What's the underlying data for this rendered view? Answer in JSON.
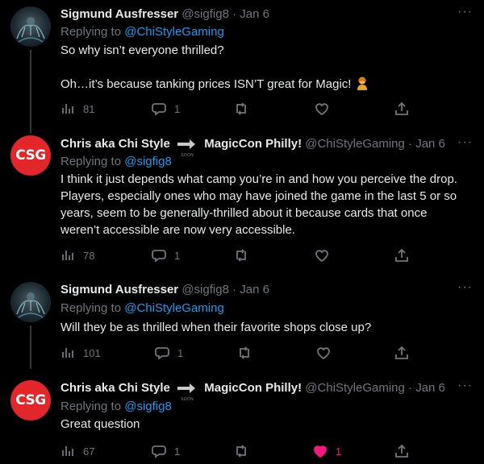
{
  "tweets": [
    {
      "name": "Sigmund Ausfresser",
      "handle": "@sigfig8",
      "dot": "·",
      "date": "Jan 6",
      "replying_prefix": "Replying to",
      "replying_to": "@ChiStyleGaming",
      "line1": "So why isn’t everyone thrilled?",
      "line2": "Oh…it’s because tanking prices ISN’T great for Magic!",
      "views": "81",
      "replies": "1",
      "retweets": "",
      "likes": ""
    },
    {
      "name": "Chris aka Chi Style",
      "name2": "MagicCon Philly!",
      "badge_text": "SOON",
      "handle": "@ChiStyleGaming",
      "dot": "·",
      "date": "Jan 6",
      "replying_prefix": "Replying to",
      "replying_to": "@sigfig8",
      "text": "I think it just depends what camp you’re in and how you perceive the drop. Players, especially ones who may have joined the game in the last 5 or so years, seem to be generally-thrilled about it because cards that once weren’t accessible are now very accessible.",
      "views": "78",
      "replies": "1",
      "retweets": "",
      "likes": ""
    },
    {
      "name": "Sigmund Ausfresser",
      "handle": "@sigfig8",
      "dot": "·",
      "date": "Jan 6",
      "replying_prefix": "Replying to",
      "replying_to": "@ChiStyleGaming",
      "text": "Will they be as thrilled when their favorite shops close up?",
      "views": "101",
      "replies": "1",
      "retweets": "",
      "likes": ""
    },
    {
      "name": "Chris aka Chi Style",
      "name2": "MagicCon Philly!",
      "badge_text": "SOON",
      "handle": "@ChiStyleGaming",
      "dot": "·",
      "date": "Jan 6",
      "replying_prefix": "Replying to",
      "replying_to": "@sigfig8",
      "text": "Great question",
      "views": "67",
      "replies": "1",
      "retweets": "",
      "likes": "1"
    }
  ],
  "avatar_csg_text": "CSG",
  "more_label": "···",
  "colors": {
    "link": "#1d9bf0",
    "muted": "#71767b",
    "like": "#f91880",
    "csg_red": "#e3262a"
  }
}
